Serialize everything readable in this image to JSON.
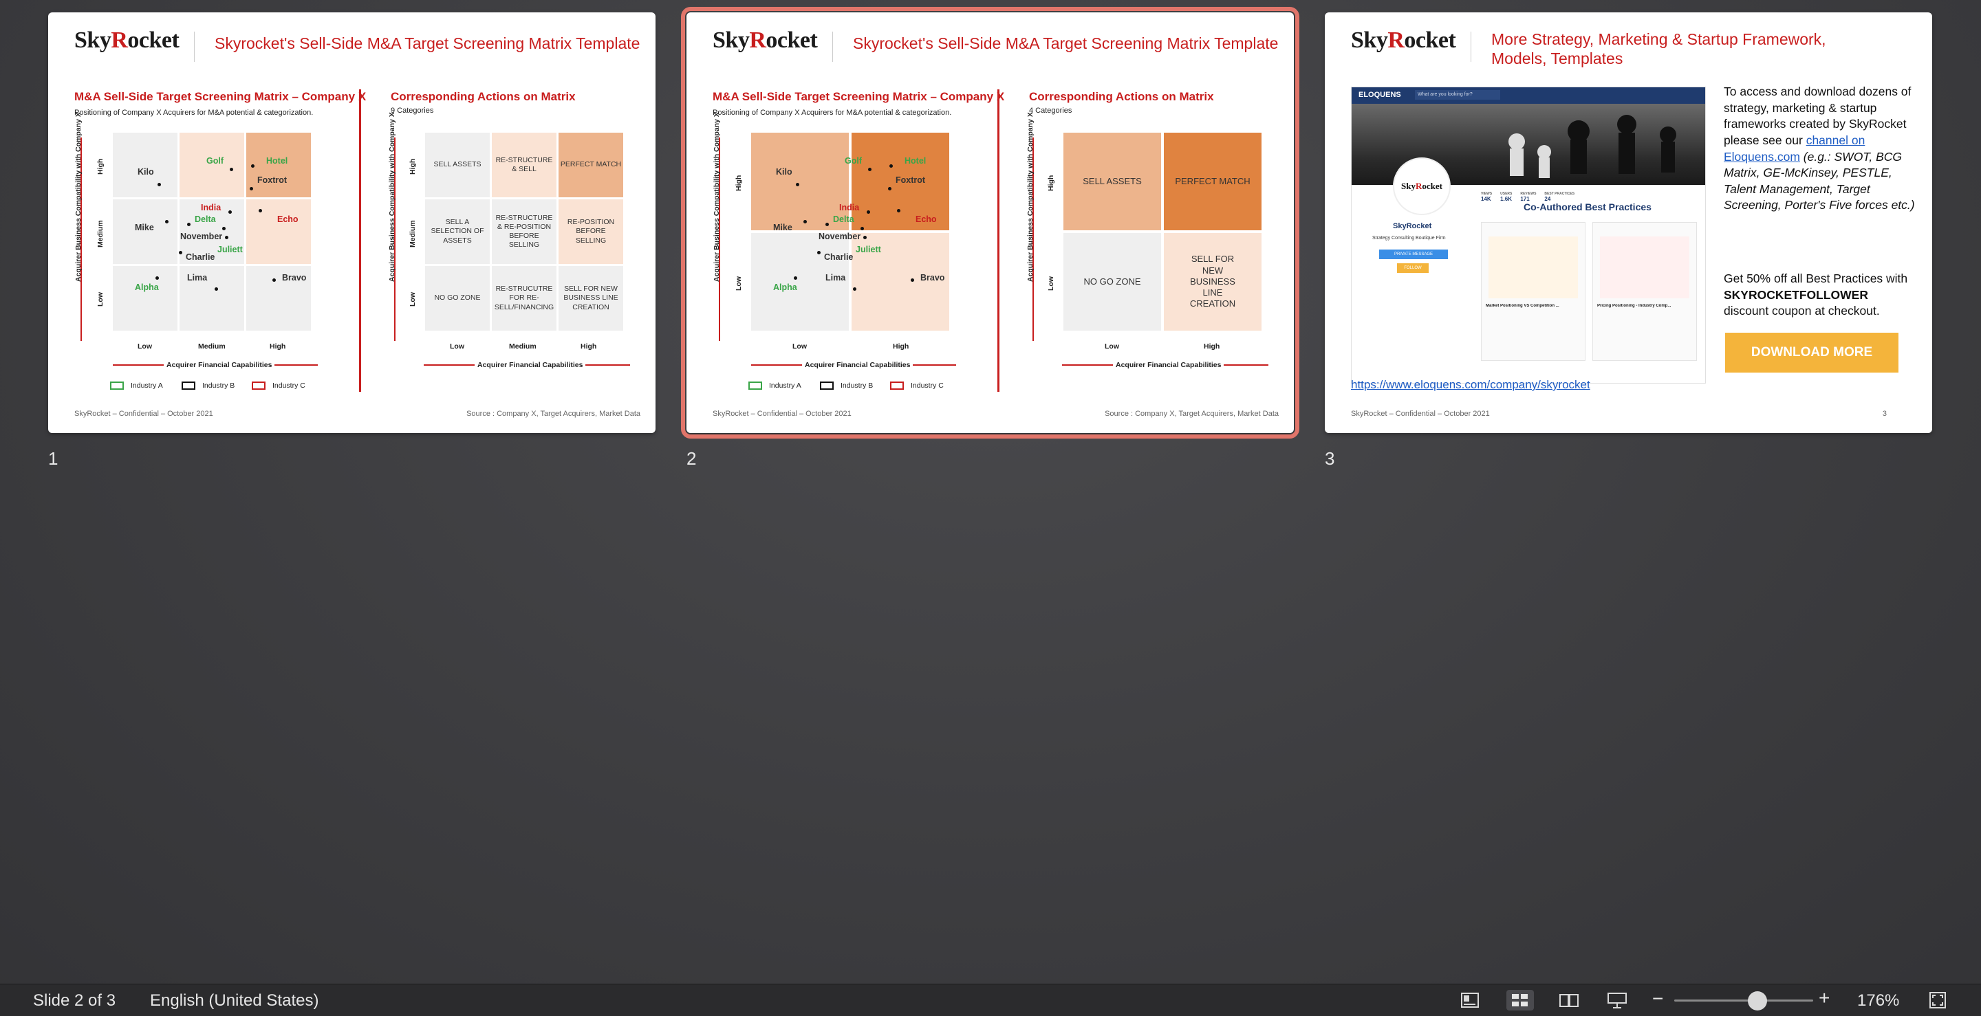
{
  "slides": [
    {
      "number": "1",
      "logo": {
        "sky": "Sky",
        "r": "R",
        "rest": "ocket"
      },
      "title": "Skyrocket's Sell-Side M&A Target Screening Matrix Template",
      "left": {
        "heading": "M&A Sell-Side Target Screening Matrix – Company X",
        "sub": "Positioning of Company X Acquirers for M&A potential & categorization."
      },
      "right": {
        "heading": "Corresponding Actions on Matrix",
        "sub": "9 Categories"
      },
      "footer_left": "SkyRocket – Confidential – October 2021",
      "footer_right": "Source : Company X, Target Acquirers, Market Data"
    },
    {
      "number": "2",
      "logo": {
        "sky": "Sky",
        "r": "R",
        "rest": "ocket"
      },
      "title": "Skyrocket's Sell-Side M&A Target Screening Matrix Template",
      "left": {
        "heading": "M&A Sell-Side Target Screening Matrix – Company X",
        "sub": "Positioning of Company X Acquirers for M&A potential & categorization."
      },
      "right": {
        "heading": "Corresponding Actions on Matrix",
        "sub": "4 Categories"
      },
      "footer_left": "SkyRocket – Confidential – October 2021",
      "footer_right": "Source : Company X, Target Acquirers, Market Data"
    },
    {
      "number": "3",
      "logo": {
        "sky": "Sky",
        "r": "R",
        "rest": "ocket"
      },
      "title": "More Strategy, Marketing & Startup Framework, Models, Templates",
      "intro": "To access and download dozens of strategy, marketing & startup frameworks created by SkyRocket please see our",
      "link_text": "channel on Eloquens.com",
      "examples": " (e.g.: SWOT, BCG Matrix, GE-McKinsey, PESTLE, Talent Management, Target Screening, Porter's Five forces etc.)",
      "discount_pre": "Get 50% off all Best Practices with",
      "discount_code": "SKYROCKETFOLLOWER",
      "discount_post": "discount coupon at checkout.",
      "button": "DOWNLOAD MORE",
      "url": "https://www.eloquens.com/company/skyrocket",
      "footer_left": "SkyRocket – Confidential – October 2021",
      "page": "3",
      "shot": {
        "brand": "ELOQUENS",
        "search": "What are you looking for?",
        "name": "SkyRocket",
        "tagline": "Strategy Consulting Boutique Firm",
        "stats_labels": [
          "VIEWS",
          "USERS",
          "REVIEWS",
          "BEST PRACTICES"
        ],
        "stats": [
          "14K",
          "1.6K",
          "171",
          "24"
        ],
        "section": "Co-Authored Best Practices",
        "card1": "Market Positioning VS Competition ...",
        "card2": "Pricing Positioning - Industry Comp...",
        "btn1": "PRIVATE MESSAGE",
        "btn2": "FOLLOW"
      }
    }
  ],
  "matrix": {
    "y_title": "Acquirer Business Compatibility with Company X",
    "x_title": "Acquirer Financial Capabilities",
    "levels3": [
      "Low",
      "Medium",
      "High"
    ],
    "levels2": [
      "Low",
      "High"
    ],
    "points": [
      {
        "name": "Kilo",
        "color": "dark"
      },
      {
        "name": "Golf",
        "color": "green"
      },
      {
        "name": "Hotel",
        "color": "green"
      },
      {
        "name": "Foxtrot",
        "color": "dark"
      },
      {
        "name": "India",
        "color": "red"
      },
      {
        "name": "Delta",
        "color": "green"
      },
      {
        "name": "Mike",
        "color": "dark"
      },
      {
        "name": "November",
        "color": "dark"
      },
      {
        "name": "Echo",
        "color": "red"
      },
      {
        "name": "Juliett",
        "color": "green"
      },
      {
        "name": "Charlie",
        "color": "dark"
      },
      {
        "name": "Lima",
        "color": "dark"
      },
      {
        "name": "Bravo",
        "color": "dark"
      },
      {
        "name": "Alpha",
        "color": "green"
      }
    ],
    "legend": [
      "Industry A",
      "Industry B",
      "Industry C"
    ],
    "actions9": [
      "SELL ASSETS",
      "RE-STRUCTURE & SELL",
      "PERFECT MATCH",
      "SELL A SELECTION OF ASSETS",
      "RE-STRUCTURE & RE-POSITION BEFORE SELLING",
      "RE-POSITION BEFORE SELLING",
      "NO GO ZONE",
      "RE-STRUCUTRE FOR RE-SELL/FINANCING",
      "SELL FOR NEW BUSINESS LINE CREATION"
    ],
    "actions4": [
      "SELL ASSETS",
      "PERFECT MATCH",
      "NO GO ZONE",
      "SELL FOR NEW BUSINESS LINE CREATION"
    ]
  },
  "status": {
    "slide_indicator": "Slide 2 of 3",
    "language": "English (United States)",
    "zoom": "176%",
    "zoom_fraction": 0.6
  },
  "colors": {
    "accent": "#c81e1e",
    "selection": "#e1756a",
    "orange_dark": "#e08340",
    "orange_mid": "#edb48c",
    "peach": "#fae3d4"
  }
}
